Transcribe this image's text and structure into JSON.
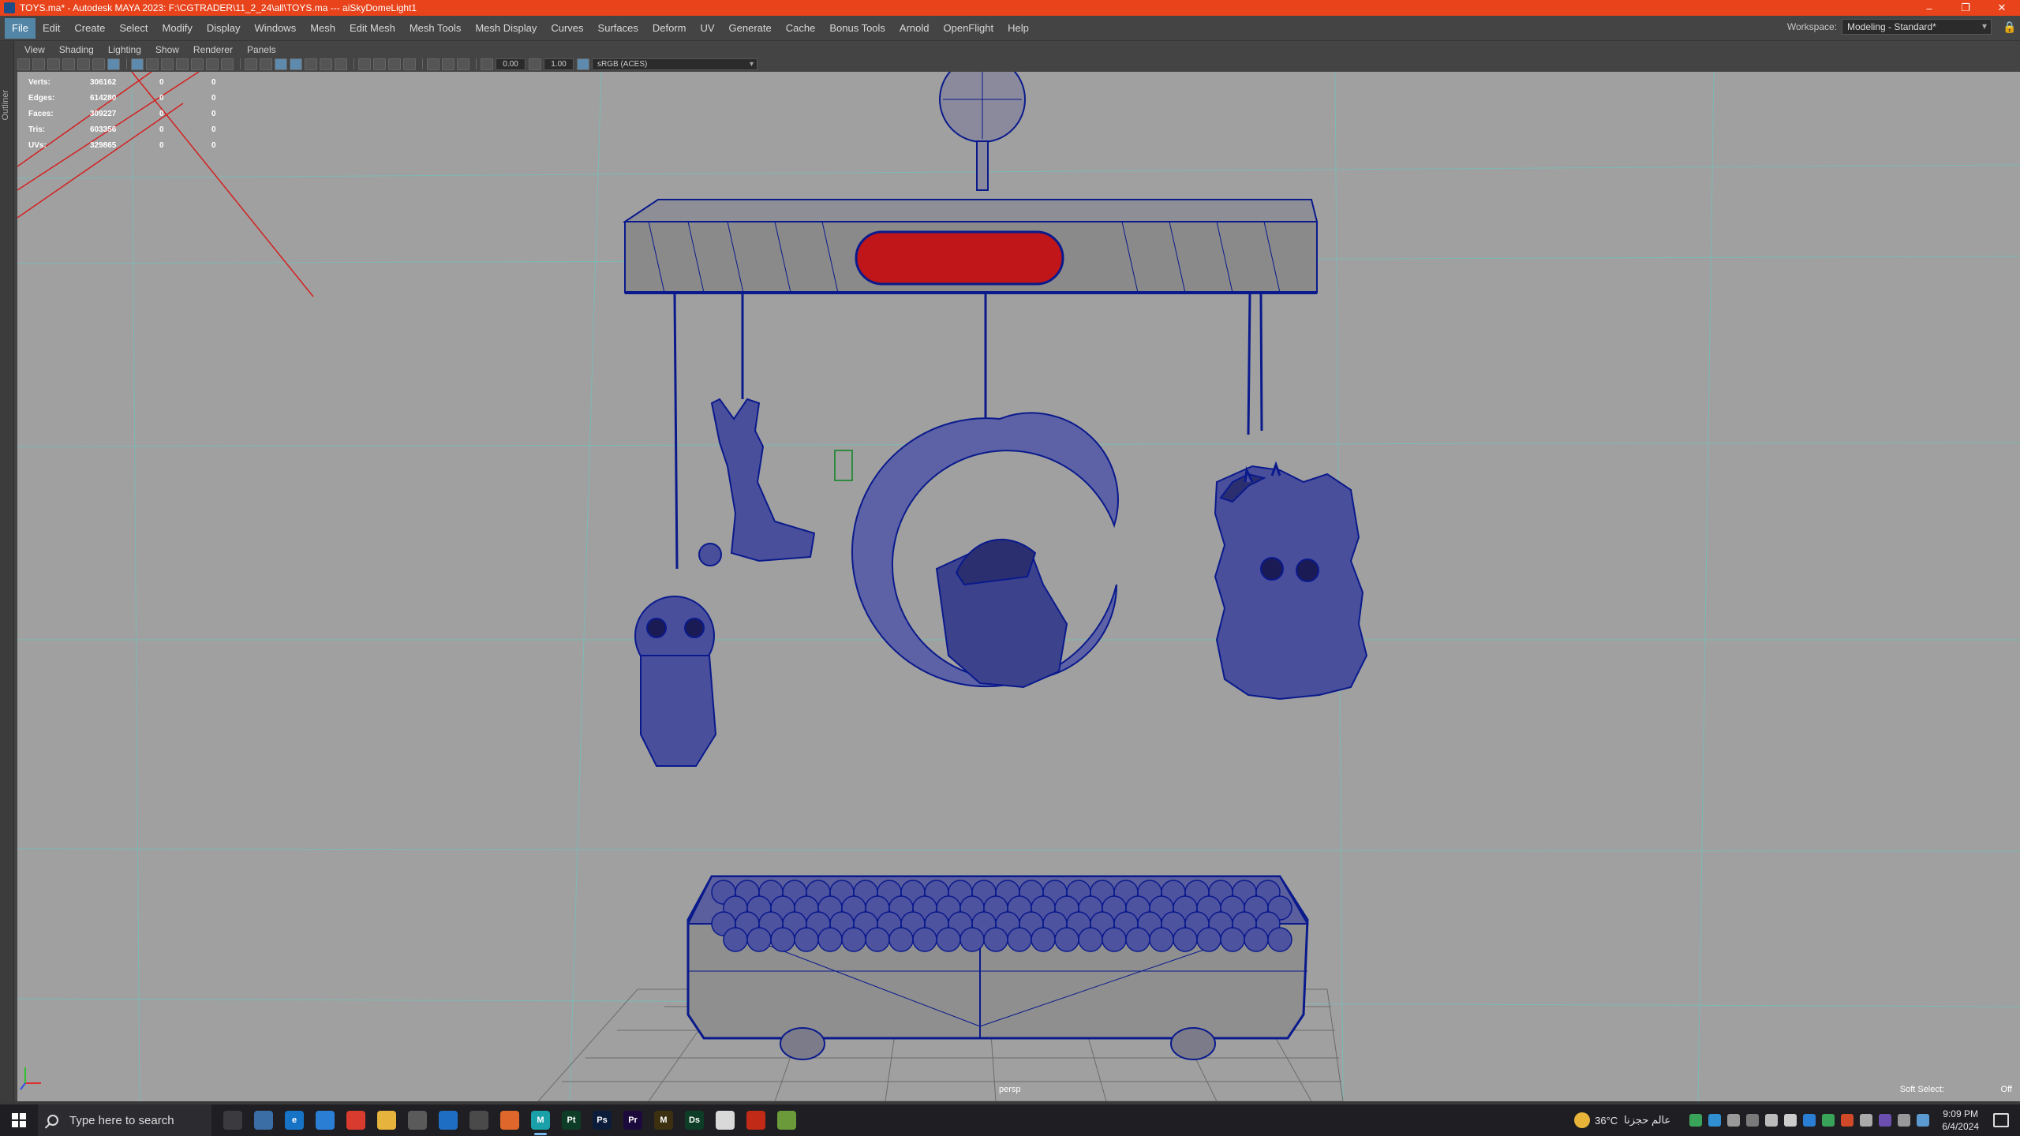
{
  "window": {
    "title": "TOYS.ma* - Autodesk MAYA 2023: F:\\CGTRADER\\11_2_24\\all\\TOYS.ma   ---   aiSkyDomeLight1",
    "minimize": "–",
    "restore": "❐",
    "close": "✕"
  },
  "menubar": {
    "items": [
      "File",
      "Edit",
      "Create",
      "Select",
      "Modify",
      "Display",
      "Windows",
      "Mesh",
      "Edit Mesh",
      "Mesh Tools",
      "Mesh Display",
      "Curves",
      "Surfaces",
      "Deform",
      "UV",
      "Generate",
      "Cache",
      "Bonus Tools",
      "Arnold",
      "OpenFlight",
      "Help"
    ],
    "active_index": 0,
    "workspace_label": "Workspace:",
    "workspace_value": "Modeling - Standard*"
  },
  "outliner_tab": "Outliner",
  "panel_menu": [
    "View",
    "Shading",
    "Lighting",
    "Show",
    "Renderer",
    "Panels"
  ],
  "panel_toolbar": {
    "exposure": "0.00",
    "gamma": "1.00",
    "colorspace": "sRGB (ACES)"
  },
  "hud": {
    "rows": [
      {
        "label": "Verts:",
        "value": "306162",
        "sel": "0",
        "extra": "0"
      },
      {
        "label": "Edges:",
        "value": "614280",
        "sel": "0",
        "extra": "0"
      },
      {
        "label": "Faces:",
        "value": "309227",
        "sel": "0",
        "extra": "0"
      },
      {
        "label": "Tris:",
        "value": "603356",
        "sel": "0",
        "extra": "0"
      },
      {
        "label": "UVs:",
        "value": "329865",
        "sel": "0",
        "extra": "0"
      }
    ]
  },
  "viewport": {
    "camera": "persp",
    "soft_select_label": "Soft Select:",
    "soft_select_value": "Off",
    "colors": {
      "background": "#a0a0a0",
      "wireframe": "#0a1a8c",
      "grid": "#5fd0c6",
      "floor_grid": "#6b6b6b",
      "accent_red": "#c0161a"
    }
  },
  "taskbar": {
    "search_placeholder": "Type here to search",
    "apps": [
      {
        "name": "task-view",
        "glyph": "",
        "color": "#3b3b3f"
      },
      {
        "name": "widgets",
        "glyph": "",
        "color": "#3a6ea5"
      },
      {
        "name": "edge",
        "glyph": "e",
        "color": "#1673c6"
      },
      {
        "name": "store",
        "glyph": "",
        "color": "#2a7fd5"
      },
      {
        "name": "chrome",
        "glyph": "",
        "color": "#d93b2f"
      },
      {
        "name": "file-explorer",
        "glyph": "",
        "color": "#e6b43d"
      },
      {
        "name": "app-circle",
        "glyph": "",
        "color": "#5a5a5a"
      },
      {
        "name": "app-blue",
        "glyph": "",
        "color": "#1e6fc4"
      },
      {
        "name": "clapper",
        "glyph": "",
        "color": "#4a4a4a"
      },
      {
        "name": "firefox",
        "glyph": "",
        "color": "#e0672b"
      },
      {
        "name": "maya",
        "glyph": "M",
        "color": "#1aa0a8"
      },
      {
        "name": "painter",
        "glyph": "Pt",
        "color": "#0d3d26"
      },
      {
        "name": "photoshop",
        "glyph": "Ps",
        "color": "#0b1d3a"
      },
      {
        "name": "premiere",
        "glyph": "Pr",
        "color": "#1d0a3d"
      },
      {
        "name": "mudbox",
        "glyph": "M",
        "color": "#3d3010"
      },
      {
        "name": "designer",
        "glyph": "Ds",
        "color": "#0d3d26"
      },
      {
        "name": "paint-app",
        "glyph": "",
        "color": "#d9d9d9"
      },
      {
        "name": "app-red",
        "glyph": "",
        "color": "#c22a18"
      },
      {
        "name": "app-green",
        "glyph": "",
        "color": "#6b9a3a"
      }
    ],
    "active_app": "maya",
    "weather": "36°C",
    "weather_text": "عالم حجزنا",
    "time": "9:09 PM",
    "date": "6/4/2024"
  }
}
